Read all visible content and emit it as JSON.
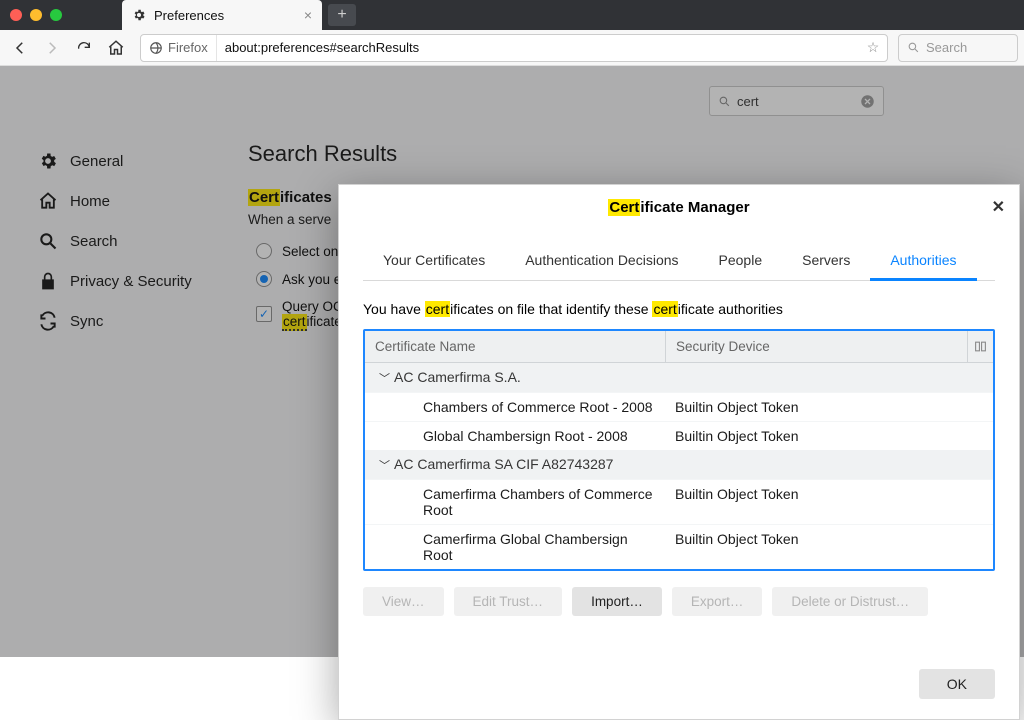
{
  "tab": {
    "title": "Preferences"
  },
  "urlbar": {
    "identity": "Firefox",
    "address": "about:preferences#searchResults"
  },
  "search_box_placeholder": "Search",
  "pref_search_value": "cert",
  "sidebar": {
    "items": [
      {
        "label": "General"
      },
      {
        "label": "Home"
      },
      {
        "label": "Search"
      },
      {
        "label": "Privacy & Security"
      },
      {
        "label": "Sync"
      }
    ]
  },
  "main": {
    "title": "Search Results",
    "section_label_pre": "Cert",
    "section_label_post": "ificates",
    "section_sub": "When a serve",
    "opt_select": "Select on",
    "opt_ask": "Ask you e",
    "opt_query_pre": "Query OC",
    "opt_query_mark": "cert",
    "opt_query_post": "ificate"
  },
  "dialog": {
    "title_pre": "Cert",
    "title_post": "ificate Manager",
    "tabs": [
      "Your Certificates",
      "Authentication Decisions",
      "People",
      "Servers",
      "Authorities"
    ],
    "active_tab_index": 4,
    "desc_parts": [
      "You have ",
      "cert",
      "ificates on file that identify these ",
      "cert",
      "ificate authorities"
    ],
    "table": {
      "col1": "Certificate Name",
      "col2": "Security Device",
      "groups": [
        {
          "name": "AC Camerfirma S.A.",
          "rows": [
            {
              "name": "Chambers of Commerce Root - 2008",
              "device": "Builtin Object Token"
            },
            {
              "name": "Global Chambersign Root - 2008",
              "device": "Builtin Object Token"
            }
          ]
        },
        {
          "name": "AC Camerfirma SA CIF A82743287",
          "rows": [
            {
              "name": "Camerfirma Chambers of Commerce Root",
              "device": "Builtin Object Token"
            },
            {
              "name": "Camerfirma Global Chambersign Root",
              "device": "Builtin Object Token"
            }
          ]
        }
      ]
    },
    "buttons": {
      "view": "View…",
      "edit": "Edit Trust…",
      "import": "Import…",
      "export": "Export…",
      "delete": "Delete or Distrust…",
      "ok": "OK"
    }
  }
}
